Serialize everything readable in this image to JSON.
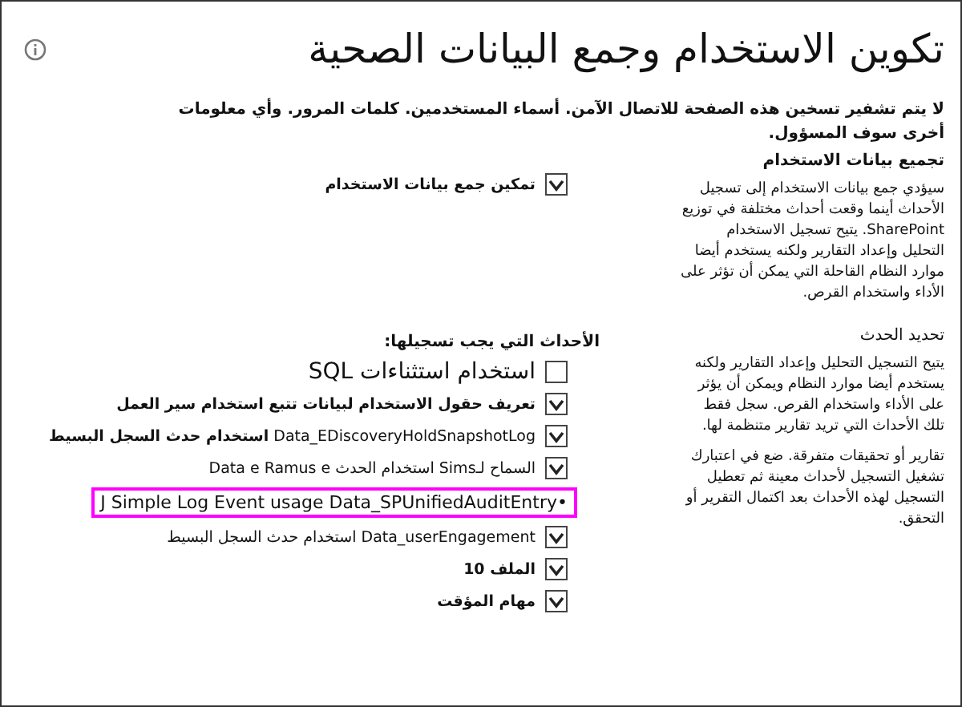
{
  "title": "تكوين الاستخدام وجمع البيانات الصحية",
  "warning": "لا يتم تشفير تسخين هذه الصفحة للاتصال الآمن. أسماء المستخدمين. كلمات المرور. وأي معلومات أخرى سوف المسؤول.",
  "sections": [
    {
      "title": "تجميع بيانات الاستخدام",
      "description": [
        "سيؤدي جمع بيانات الاستخدام إلى تسجيل الأحداث أينما وقعت أحداث مختلفة في توزيع SharePoint. يتيح تسجيل الاستخدام التحليل وإعداد التقارير ولكنه يستخدم أيضا موارد النظام القاحلة التي يمكن أن تؤثر على الأداء واستخدام القرص."
      ],
      "items": [
        {
          "kind": "checkbox",
          "label": "تمكين جمع بيانات الاستخدام",
          "checked": true,
          "bold": true
        }
      ]
    },
    {
      "title": "تحديد الحدث",
      "description": [
        "يتيح التسجيل التحليل وإعداد التقارير ولكنه يستخدم أيضا موارد النظام ويمكن أن يؤثر على الأداء واستخدام القرص. سجل فقط تلك الأحداث التي تريد تقارير متنظمة لها.",
        "تقارير أو تحقيقات متفرقة. ضع في اعتبارك تشغيل التسجيل لأحداث معينة ثم تعطيل التسجيل لهذه الأحداث بعد اكتمال التقرير أو التحقق."
      ],
      "heading": "الأحداث التي يجب تسجيلها:",
      "items": [
        {
          "kind": "large-checkbox",
          "label": "استخدام  استثناءات SQL",
          "checked": false,
          "bold": false
        },
        {
          "kind": "checkbox",
          "label": "تعريف حقول الاستخدام لبيانات تتبع استخدام سير العمل",
          "checked": true,
          "bold": true
        },
        {
          "kind": "checkbox",
          "label": "Data_EDiscoveryHoldSnapshotLog **استخدام حدث السجل البسيط**",
          "checked": true,
          "bold": false
        },
        {
          "kind": "checkbox",
          "label": "السماح لـSims استخدام الحدث Data e Ramus e",
          "checked": true,
          "bold": false
        },
        {
          "kind": "highlight",
          "label": "J Simple Log Event usage Data_SPUnifiedAuditEntry•"
        },
        {
          "kind": "checkbox",
          "label": "Data_userEngagement استخدام حدث السجل البسيط",
          "checked": true,
          "bold": false
        },
        {
          "kind": "checkbox",
          "label": "الملف 10",
          "checked": true,
          "bold": true
        },
        {
          "kind": "checkbox",
          "label": "مهام المؤقت",
          "checked": true,
          "bold": true
        }
      ]
    }
  ]
}
